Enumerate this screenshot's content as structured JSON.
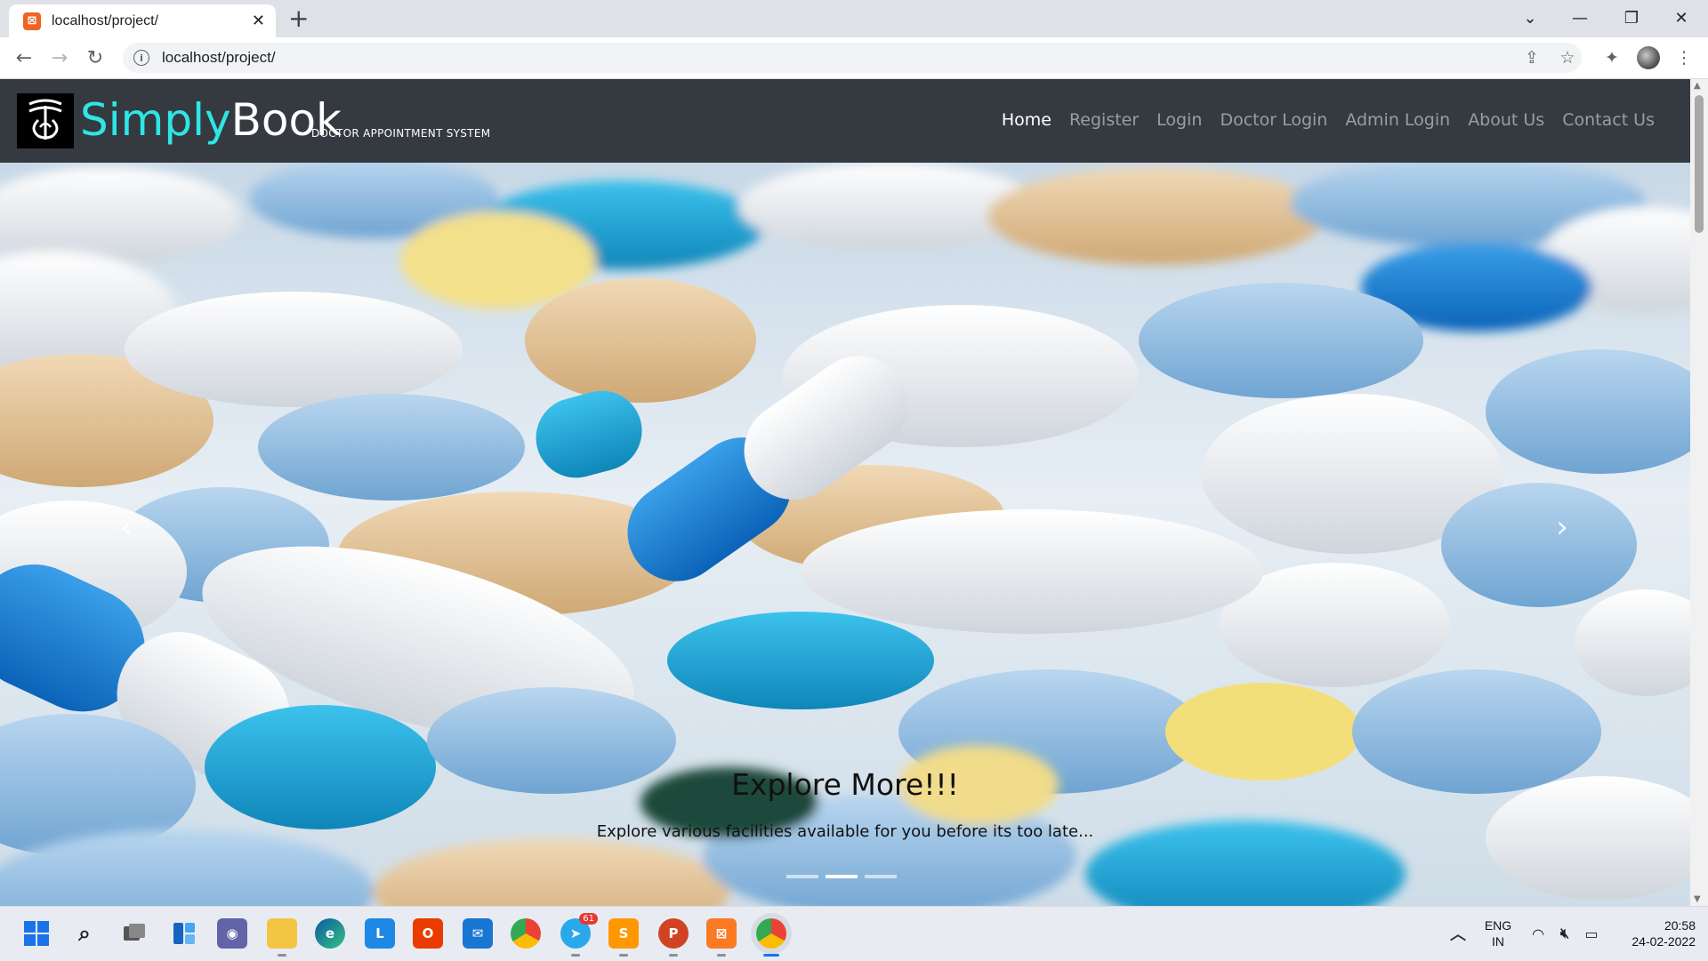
{
  "browser": {
    "tab_title": "localhost/project/",
    "url": "localhost/project/",
    "favicon_glyph": "⊠",
    "new_tab_label": "+"
  },
  "site": {
    "brand_part1": "Simply",
    "brand_part2": "Book",
    "tagline": "DOCTOR APPOINTMENT SYSTEM",
    "nav": [
      {
        "label": "Home",
        "active": true
      },
      {
        "label": "Register"
      },
      {
        "label": "Login"
      },
      {
        "label": "Doctor Login"
      },
      {
        "label": "Admin Login"
      },
      {
        "label": "About Us"
      },
      {
        "label": "Contact Us"
      }
    ],
    "colors": {
      "navbar": "#343a40",
      "brand_accent": "#2ee6e6"
    }
  },
  "carousel": {
    "caption_title": "Explore More!!!",
    "caption_text": "Explore various facilities available for you before its too late...",
    "slide_count": 3,
    "active_slide": 2,
    "prev_icon": "chevron-left-icon",
    "next_icon": "chevron-right-icon"
  },
  "taskbar": {
    "telegram_badge": "61",
    "language_line1": "ENG",
    "language_line2": "IN",
    "time": "20:58",
    "date": "24-02-2022"
  }
}
